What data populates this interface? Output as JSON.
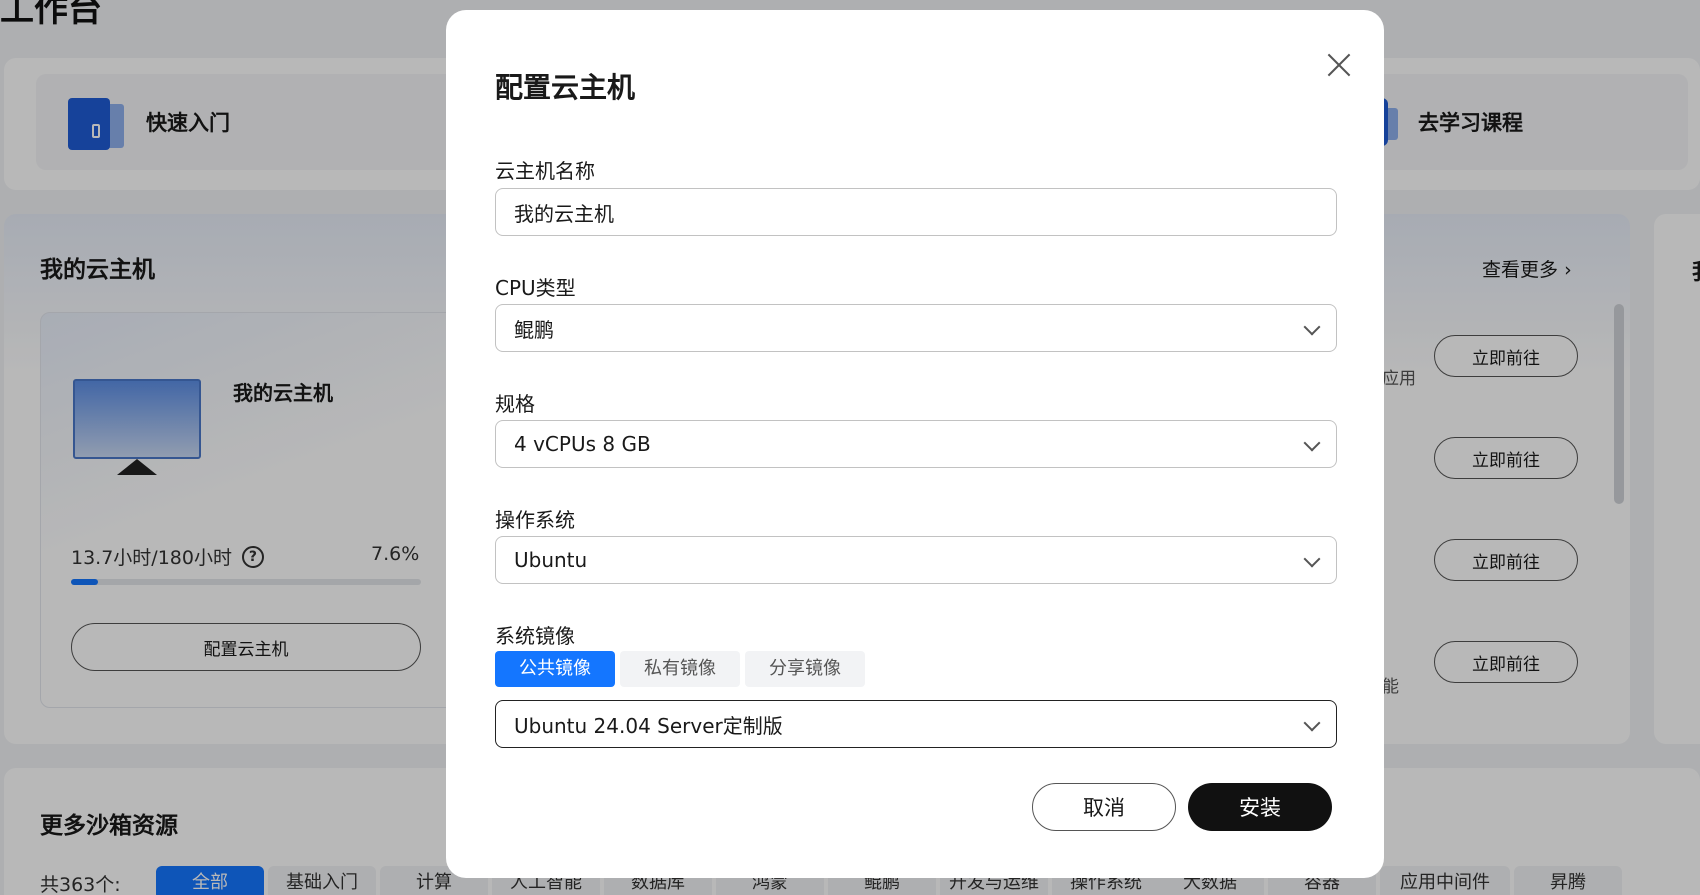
{
  "page": {
    "title": "工作台"
  },
  "quick_links": [
    {
      "label": "快速入门",
      "icon": "book-icon"
    },
    {
      "label": "去学习课程",
      "icon": "video-icon"
    }
  ],
  "my_hosts": {
    "title": "我的云主机",
    "card": {
      "name": "我的云主机",
      "usage": "13.7小时/180小时",
      "percent": "7.6%",
      "progress": 0.076,
      "configure_label": "配置云主机"
    },
    "view_more": "查看更多",
    "go_label": "立即前往",
    "fragments": [
      "应用",
      "能"
    ]
  },
  "right_panel_title": "我",
  "sandbox": {
    "title": "更多沙箱资源",
    "total": "共363个:",
    "tabs": [
      "全部",
      "基础入门",
      "计算",
      "人工智能",
      "数据库",
      "鸿蒙",
      "鲲鹏",
      "开发与运维",
      "操作系统",
      "大数据",
      "容器",
      "应用中间件",
      "昇腾"
    ]
  },
  "modal": {
    "title": "配置云主机",
    "name_label": "云主机名称",
    "name_value": "我的云主机",
    "cpu_label": "CPU类型",
    "cpu_value": "鲲鹏",
    "spec_label": "规格",
    "spec_value": "4 vCPUs 8 GB",
    "os_label": "操作系统",
    "os_value": "Ubuntu",
    "image_label": "系统镜像",
    "image_tabs": [
      "公共镜像",
      "私有镜像",
      "分享镜像"
    ],
    "image_value": "Ubuntu 24.04 Server定制版",
    "cancel_label": "取消",
    "install_label": "安装"
  },
  "colors": {
    "accent": "#1476ff",
    "primary_button": "#111111"
  }
}
